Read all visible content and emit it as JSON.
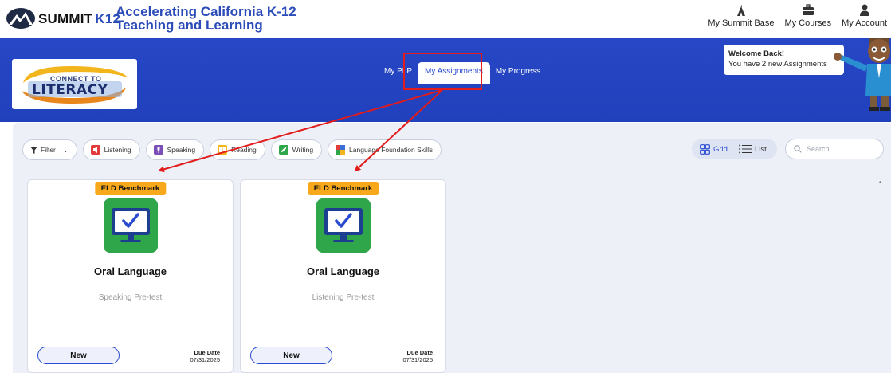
{
  "brand": {
    "name": "SUMMIT",
    "suffix": "K12",
    "tagline_line1": "Accelerating California K-12",
    "tagline_line2": "Teaching and Learning"
  },
  "topnav": [
    {
      "label": "My Summit Base",
      "icon": "summit-base-icon"
    },
    {
      "label": "My Courses",
      "icon": "briefcase-icon"
    },
    {
      "label": "My Account",
      "icon": "user-icon"
    }
  ],
  "banner": {
    "logo_small": "CONNECT TO",
    "logo_big": "LITERACY"
  },
  "tabs": [
    {
      "label": "My PLP",
      "active": false
    },
    {
      "label": "My Assignments",
      "active": true
    },
    {
      "label": "My Progress",
      "active": false
    }
  ],
  "welcome": {
    "title": "Welcome Back!",
    "message": "You have 2 new Assignments"
  },
  "filters": {
    "filter_label": "Filter",
    "chips": [
      {
        "label": "Listening",
        "color": "#e23b3b"
      },
      {
        "label": "Speaking",
        "color": "#7b4fb8"
      },
      {
        "label": "Reading",
        "color": "#f2b51c"
      },
      {
        "label": "Writing",
        "color": "#2fa64a"
      },
      {
        "label": "Language Foundation Skills",
        "color": "#3b6fd6"
      }
    ]
  },
  "view": {
    "grid_label": "Grid",
    "list_label": "List",
    "active": "Grid"
  },
  "search": {
    "placeholder": "Search",
    "value": ""
  },
  "cards": [
    {
      "badge": "ELD Benchmark",
      "title": "Oral Language",
      "subtitle": "Speaking Pre-test",
      "status": "New",
      "due_label": "Due Date",
      "due_date": "07/31/2025"
    },
    {
      "badge": "ELD Benchmark",
      "title": "Oral Language",
      "subtitle": "Listening Pre-test",
      "status": "New",
      "due_label": "Due Date",
      "due_date": "07/31/2025"
    }
  ],
  "colors": {
    "banner": "#2040bc",
    "accent": "#2a4bd0",
    "badge": "#f7a81b",
    "annotation": "#e21b1b",
    "card_icon": "#2fa64a"
  }
}
